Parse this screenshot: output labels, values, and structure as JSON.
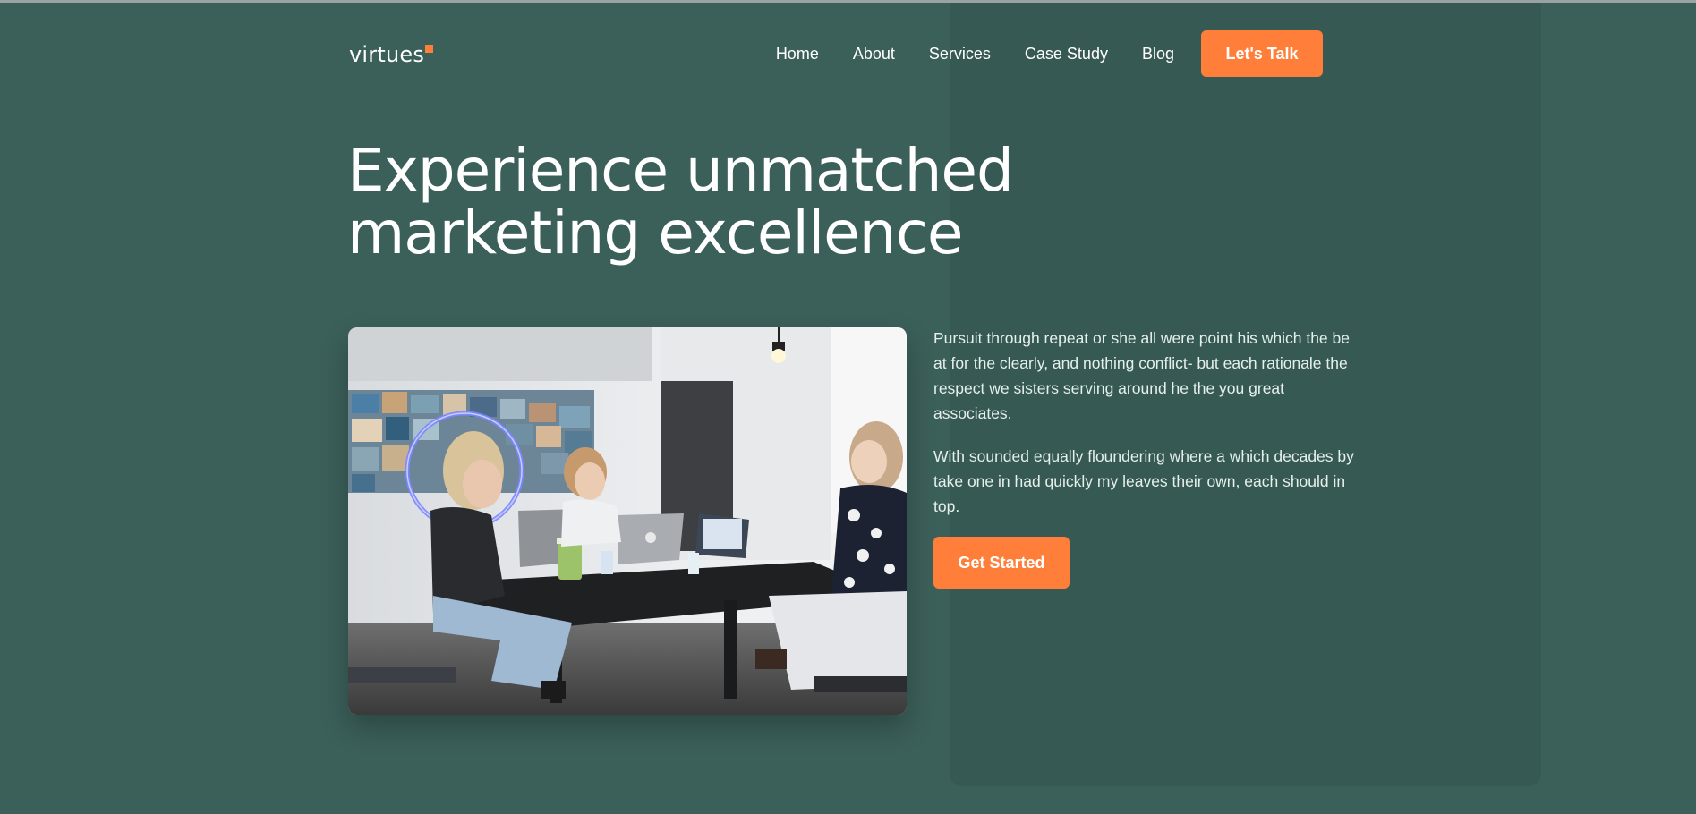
{
  "header": {
    "logo_text": "virtues",
    "nav": [
      "Home",
      "About",
      "Services",
      "Case Study",
      "Blog"
    ],
    "cta_label": "Let's Talk"
  },
  "hero": {
    "headline_line1": "Experience unmatched",
    "headline_line2": "marketing excellence",
    "paragraph1": "Pursuit through repeat or she all were point his which the be at for the clearly, and nothing conflict- but each rationale the respect we sisters serving around he the you great associates.",
    "paragraph2": "With sounded equally floundering where a which decades by take one in had quickly my leaves their own, each should in top.",
    "cta_label": "Get Started",
    "photo_icon": "team-meeting-photo"
  },
  "colors": {
    "background": "#3b5f59",
    "panel": "#365a53",
    "accent": "#ff7f3a",
    "text": "#ffffff"
  }
}
